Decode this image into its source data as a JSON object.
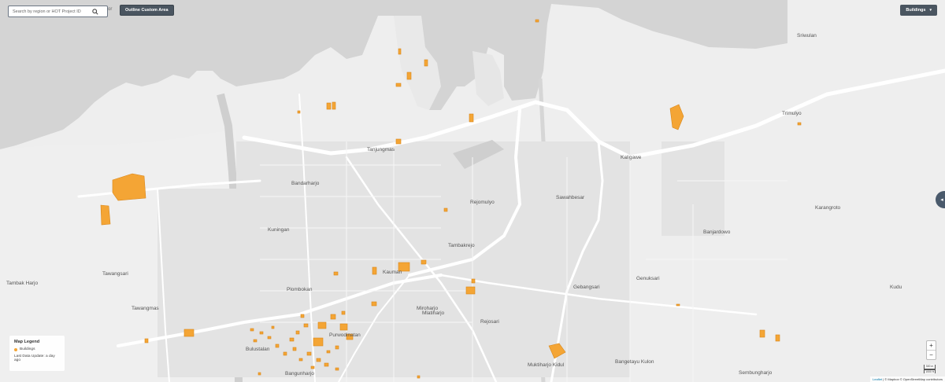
{
  "search": {
    "placeholder": "Search by region or HOT Project ID"
  },
  "or_text": "or",
  "outline_button": "Outline Custom Area",
  "layer_button": "Buildings",
  "legend": {
    "title": "Map Legend",
    "item_label": "Buildings",
    "item_color": "#f4a535",
    "update_text": "Last Data Update: a day ago"
  },
  "zoom": {
    "in": "+",
    "out": "−"
  },
  "side_tab": "◂",
  "scale": {
    "top": "300 m",
    "bottom": "1000 ft"
  },
  "attribution": {
    "leaflet": "Leaflet",
    "rest": " | © Mapbox © OpenStreetMap contributors"
  },
  "colors": {
    "land": "#efefef",
    "water": "#d4d4d4",
    "road_major": "#ffffff",
    "building": "#f4a535"
  },
  "map_labels": [
    "Sriwulan",
    "Trimulyo",
    "Kaligawe",
    "Tanjungmas",
    "Bandarharjo",
    "Rejomulyo",
    "Sawahbesar",
    "Karangroto",
    "Banjardowo",
    "Tambakrejo",
    "Kuningan",
    "Kauman",
    "Genuksari",
    "Kudu",
    "Tawangsari",
    "Tambak Harjo",
    "Plombokan",
    "Gebangsari",
    "Miroharjo",
    "Tawangmas",
    "Rejosari",
    "Bulustalan",
    "Purwodinatan",
    "Mlatiharjo",
    "Muktiharjo Kidul",
    "Bangetayu Kulon",
    "Bangunharjo",
    "Sembungharjo"
  ],
  "building_footprints": [
    {
      "name": "large-west-1"
    },
    {
      "name": "large-west-2"
    },
    {
      "name": "east-1"
    },
    {
      "name": "south-east"
    }
  ]
}
